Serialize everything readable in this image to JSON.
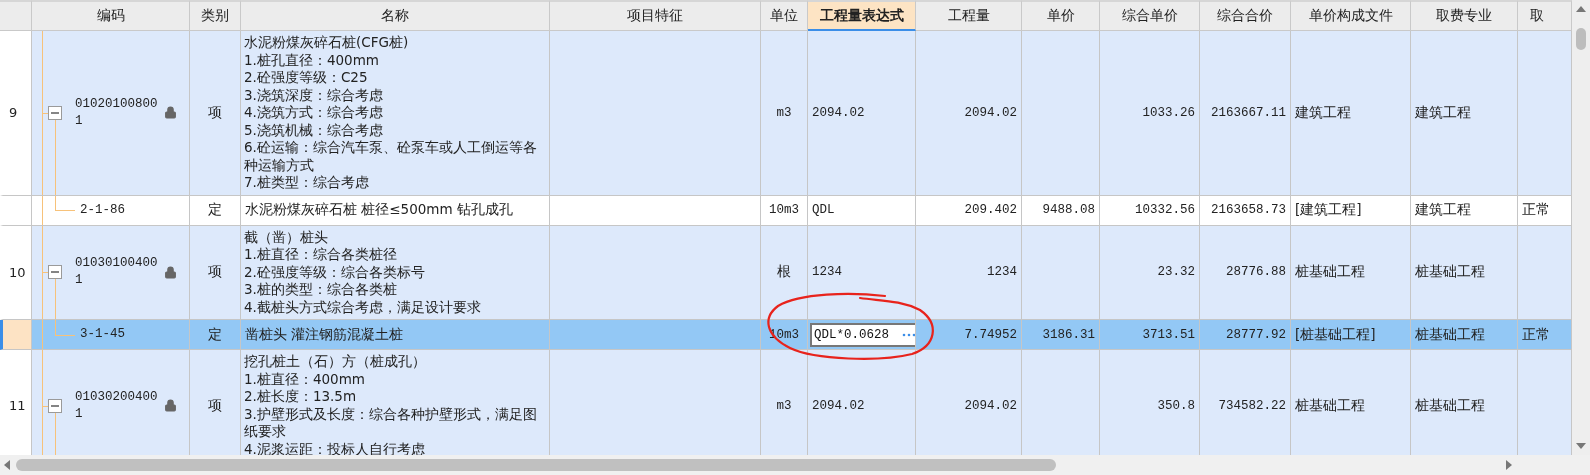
{
  "columns": [
    {
      "label": "编码",
      "selected": false
    },
    {
      "label": "类别",
      "selected": false
    },
    {
      "label": "名称",
      "selected": false
    },
    {
      "label": "项目特征",
      "selected": false
    },
    {
      "label": "单位",
      "selected": false
    },
    {
      "label": "工程量表达式",
      "selected": true
    },
    {
      "label": "工程量",
      "selected": false
    },
    {
      "label": "单价",
      "selected": false
    },
    {
      "label": "综合单价",
      "selected": false
    },
    {
      "label": "综合合价",
      "selected": false
    },
    {
      "label": "单价构成文件",
      "selected": false
    },
    {
      "label": "取费专业",
      "selected": false
    },
    {
      "label": "取",
      "selected": false
    }
  ],
  "rows": [
    {
      "number": "9",
      "kind": "item",
      "selected": false,
      "editing": false,
      "expanded": true,
      "locked": true,
      "code": "010201008001",
      "type": "项",
      "name": "水泥粉煤灰碎石桩(CFG桩)\n1.桩孔直径：400mm\n2.砼强度等级：C25\n3.浇筑深度：综合考虑\n4.浇筑方式：综合考虑\n5.浇筑机械：综合考虑\n6.砼运输：综合汽车泵、砼泵车或人工倒运等各种运输方式\n7.桩类型：综合考虑",
      "unit": "m3",
      "expression": "2094.02",
      "quantity": "2094.02",
      "composite_unit_price": "1033.26",
      "composite_total": "2163667.11",
      "price_file": "建筑工程",
      "fee_specialty": "建筑工程"
    },
    {
      "kind": "sub",
      "selected": false,
      "editing": false,
      "code": "2-1-86",
      "type": "定",
      "name": "水泥粉煤灰碎石桩 桩径≤500mm 钻孔成孔",
      "unit": "10m3",
      "expression": "QDL",
      "quantity": "209.402",
      "unit_price": "9488.08",
      "composite_unit_price": "10332.56",
      "composite_total": "2163658.73",
      "price_file": "[建筑工程]",
      "fee_specialty": "建筑工程",
      "fee_type": "正常"
    },
    {
      "number": "10",
      "kind": "item",
      "selected": false,
      "editing": false,
      "expanded": true,
      "locked": true,
      "code": "010301004001",
      "type": "项",
      "name": "截（凿）桩头\n1.桩直径：综合各类桩径\n2.砼强度等级：综合各类标号\n3.桩的类型：综合各类桩\n4.截桩头方式综合考虑，满足设计要求",
      "unit": "根",
      "expression": "1234",
      "quantity": "1234",
      "composite_unit_price": "23.32",
      "composite_total": "28776.88",
      "price_file": "桩基础工程",
      "fee_specialty": "桩基础工程"
    },
    {
      "kind": "sub",
      "selected": true,
      "editing": true,
      "code": "3-1-45",
      "type": "定",
      "name": "凿桩头 灌注钢筋混凝土桩",
      "unit": "10m3",
      "expression": "QDL*0.0628",
      "quantity": "7.74952",
      "unit_price": "3186.31",
      "composite_unit_price": "3713.51",
      "composite_total": "28777.92",
      "price_file": "[桩基础工程]",
      "fee_specialty": "桩基础工程",
      "fee_type": "正常"
    },
    {
      "number": "11",
      "kind": "item",
      "selected": false,
      "editing": false,
      "expanded": true,
      "locked": true,
      "code": "010302004001",
      "type": "项",
      "name": "挖孔桩土（石）方（桩成孔）\n1.桩直径：400mm\n2.桩长度：13.5m\n3.护壁形式及长度：综合各种护壁形式，满足图纸要求\n4.泥浆运距：投标人自行考虑",
      "unit": "m3",
      "expression": "2094.02",
      "quantity": "2094.02",
      "composite_unit_price": "350.8",
      "composite_total": "734582.22",
      "price_file": "桩基础工程",
      "fee_specialty": "桩基础工程"
    }
  ]
}
